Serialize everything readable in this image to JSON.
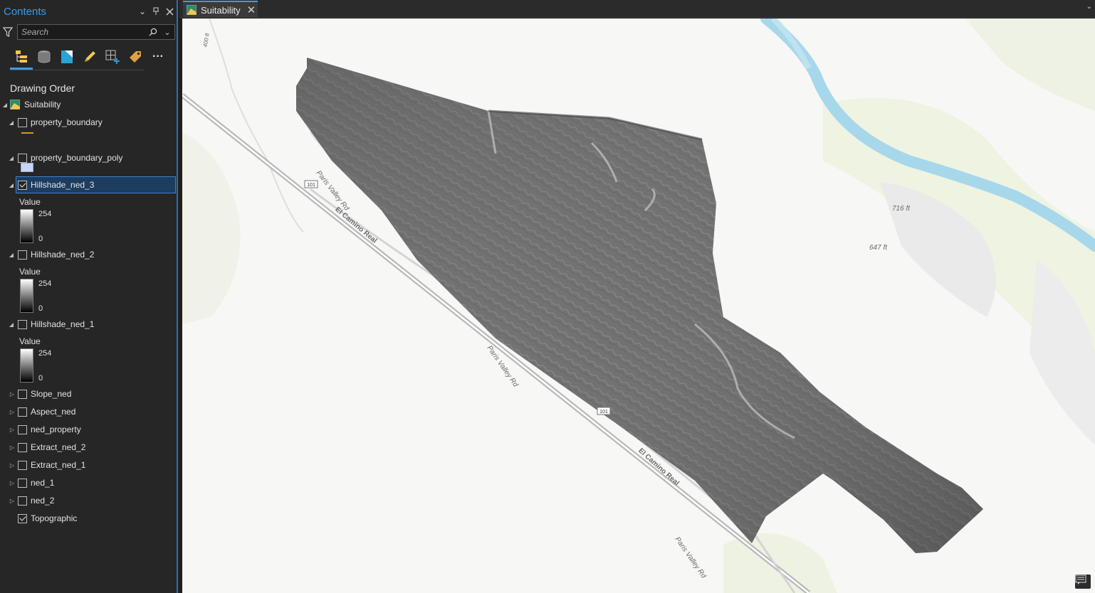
{
  "pane": {
    "title": "Contents",
    "search_placeholder": "Search",
    "section_title": "Drawing Order",
    "map_name": "Suitability",
    "toolbar_icons": [
      "list-by-drawing-order-icon",
      "list-by-data-source-icon",
      "list-by-selection-icon",
      "list-by-editing-icon",
      "list-by-snapping-icon",
      "list-by-labeling-icon",
      "more-icon"
    ]
  },
  "layers": [
    {
      "name": "property_boundary",
      "checked": false,
      "expanded": true
    },
    {
      "name": "property_boundary_poly",
      "checked": false,
      "expanded": true
    },
    {
      "name": "Hillshade_ned_3",
      "checked": true,
      "expanded": true,
      "selected": true,
      "legend": {
        "title": "Value",
        "high": "254",
        "low": "0"
      }
    },
    {
      "name": "Hillshade_ned_2",
      "checked": false,
      "expanded": true,
      "legend": {
        "title": "Value",
        "high": "254",
        "low": "0"
      }
    },
    {
      "name": "Hillshade_ned_1",
      "checked": false,
      "expanded": true,
      "legend": {
        "title": "Value",
        "high": "254",
        "low": "0"
      }
    },
    {
      "name": "Slope_ned",
      "checked": false,
      "expanded": false
    },
    {
      "name": "Aspect_ned",
      "checked": false,
      "expanded": false
    },
    {
      "name": "ned_property",
      "checked": false,
      "expanded": false
    },
    {
      "name": "Extract_ned_2",
      "checked": false,
      "expanded": false
    },
    {
      "name": "Extract_ned_1",
      "checked": false,
      "expanded": false
    },
    {
      "name": "ned_1",
      "checked": false,
      "expanded": false
    },
    {
      "name": "ned_2",
      "checked": false,
      "expanded": false
    },
    {
      "name": "Topographic",
      "checked": true,
      "expanded": null
    }
  ],
  "map_tab": {
    "label": "Suitability"
  },
  "map_labels": {
    "road_1": "Paris Valley Rd",
    "road_2": "El Camino Real",
    "road_3": "Paris Valley Rd",
    "road_4": "El Camino Real",
    "road_5": "Paris Valley Rd",
    "elev_1": "716 ft",
    "elev_2": "647 ft",
    "elev_3": "400 ft",
    "shield_1": "101",
    "shield_2": "101"
  },
  "colors": {
    "accent": "#3d9be9",
    "pane_bg": "#262626",
    "map_bg": "#f7f7f5",
    "river": "#a7d7ea",
    "hillshade": "#6e6e6e"
  }
}
